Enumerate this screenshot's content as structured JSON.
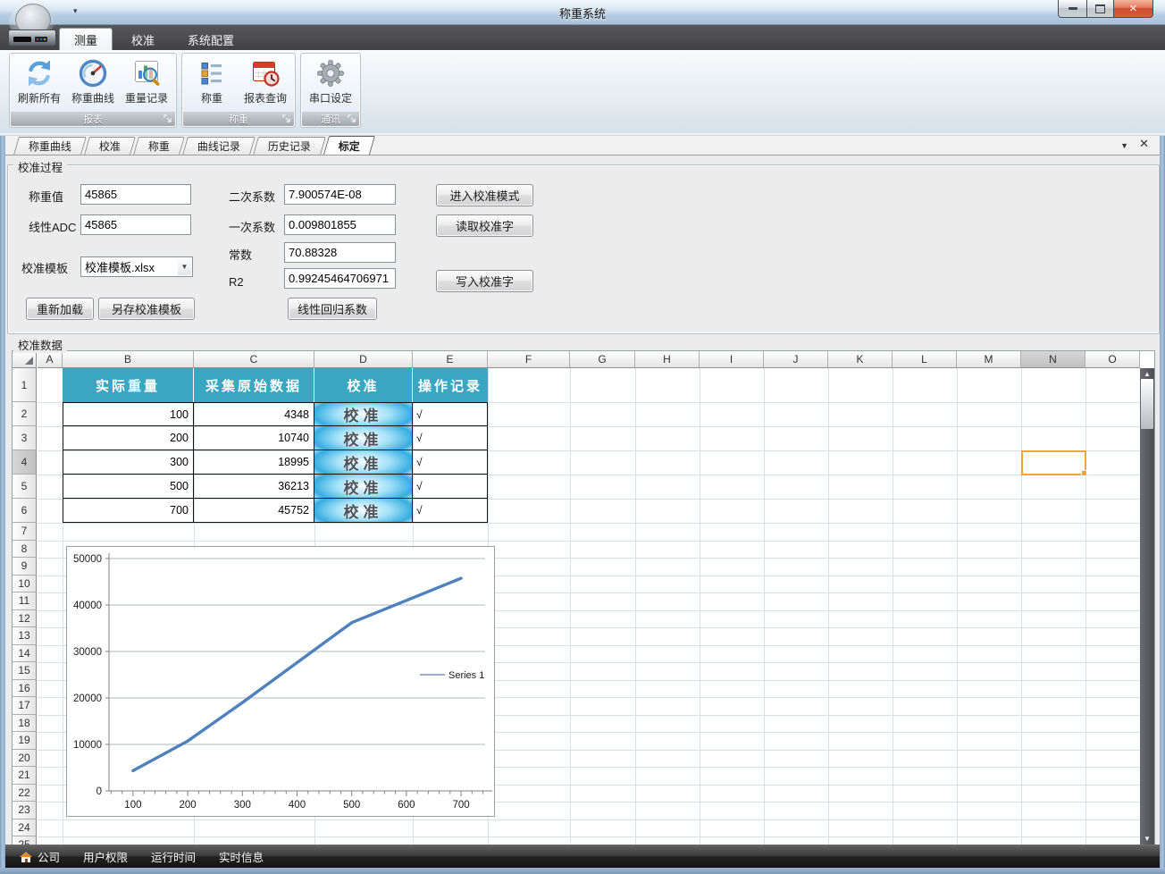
{
  "colors": {
    "accent_teal": "#3AA6C2",
    "selection_orange": "#F0A43C",
    "chart_line": "#4F81BD",
    "glow_blue": "#36ACE0"
  },
  "window": {
    "title": "称重系统"
  },
  "ribbon": {
    "tabs": [
      {
        "name": "measure",
        "label": "测量",
        "active": true
      },
      {
        "name": "calibrate",
        "label": "校准",
        "active": false
      },
      {
        "name": "system-config",
        "label": "系统配置",
        "active": false
      }
    ],
    "groups": [
      {
        "name": "reports",
        "label": "报表",
        "buttons": [
          {
            "name": "refresh-all",
            "label": "刷新所有",
            "icon": "refresh-icon"
          },
          {
            "name": "weigh-curve",
            "label": "称重曲线",
            "icon": "gauge-icon"
          },
          {
            "name": "weight-records",
            "label": "重量记录",
            "icon": "chart-search-icon"
          }
        ]
      },
      {
        "name": "weighing",
        "label": "称重",
        "buttons": [
          {
            "name": "weigh",
            "label": "称重",
            "icon": "list-icon"
          },
          {
            "name": "report-query",
            "label": "报表查询",
            "icon": "calendar-clock-icon"
          }
        ]
      },
      {
        "name": "communication",
        "label": "通讯",
        "buttons": [
          {
            "name": "serial-port-settings",
            "label": "串口设定",
            "icon": "gear-icon"
          }
        ]
      }
    ]
  },
  "doc_tabs": [
    {
      "name": "weigh-curve",
      "label": "称重曲线",
      "active": false
    },
    {
      "name": "calibrate",
      "label": "校准",
      "active": false
    },
    {
      "name": "weigh",
      "label": "称重",
      "active": false
    },
    {
      "name": "curve-records",
      "label": "曲线记录",
      "active": false
    },
    {
      "name": "history-records",
      "label": "历史记录",
      "active": false
    },
    {
      "name": "calibration",
      "label": "标定",
      "active": true
    }
  ],
  "calibration_panel": {
    "group_title": "校准过程",
    "fields": [
      {
        "name": "weigh-value",
        "label": "称重值",
        "value": "45865",
        "type": "input"
      },
      {
        "name": "linear-adc",
        "label": "线性ADC",
        "value": "45865",
        "type": "input"
      },
      {
        "name": "calibration-template",
        "label": "校准模板",
        "value": "校准模板.xlsx",
        "type": "combo"
      },
      {
        "name": "quadratic-coefficient",
        "label": "二次系数",
        "value": "7.900574E-08",
        "type": "input"
      },
      {
        "name": "linear-coefficient",
        "label": "一次系数",
        "value": "0.009801855",
        "type": "input"
      },
      {
        "name": "constant",
        "label": "常数",
        "value": "70.88328",
        "type": "input"
      },
      {
        "name": "r2",
        "label": "R2",
        "value": "0.99245464706971",
        "type": "input"
      }
    ],
    "buttons": [
      {
        "name": "reload",
        "label": "重新加载"
      },
      {
        "name": "save-template-as",
        "label": "另存校准模板"
      },
      {
        "name": "linear-regression",
        "label": "线性回归系数"
      },
      {
        "name": "enter-calibration-mode",
        "label": "进入校准模式"
      },
      {
        "name": "read-calibration-word",
        "label": "读取校准字"
      },
      {
        "name": "write-calibration-word",
        "label": "写入校准字"
      }
    ]
  },
  "sheet": {
    "group_title": "校准数据",
    "columns": [
      "A",
      "B",
      "C",
      "D",
      "E",
      "F",
      "G",
      "H",
      "I",
      "J",
      "K",
      "L",
      "M",
      "N",
      "O"
    ],
    "row_count": 25,
    "selected_column": "N",
    "selected_row": 4,
    "selected_cell": "N4",
    "table": {
      "headers": [
        "实际重量",
        "采集原始数据",
        "校准",
        "操作记录"
      ],
      "rows": [
        {
          "weight": "100",
          "raw": "4348",
          "action": "校准",
          "log": "√"
        },
        {
          "weight": "200",
          "raw": "10740",
          "action": "校准",
          "log": "√"
        },
        {
          "weight": "300",
          "raw": "18995",
          "action": "校准",
          "log": "√"
        },
        {
          "weight": "500",
          "raw": "36213",
          "action": "校准",
          "log": "√"
        },
        {
          "weight": "700",
          "raw": "45752",
          "action": "校准",
          "log": "√"
        }
      ]
    }
  },
  "chart_data": {
    "type": "line",
    "title": "",
    "series": [
      {
        "name": "Series 1",
        "x": [
          100,
          200,
          300,
          500,
          700
        ],
        "y": [
          4348,
          10740,
          18995,
          36213,
          45752
        ]
      }
    ],
    "xticks": [
      100,
      200,
      300,
      400,
      500,
      600,
      700
    ],
    "yticks": [
      0,
      10000,
      20000,
      30000,
      40000,
      50000
    ],
    "xlim": [
      56,
      744
    ],
    "ylim": [
      0,
      50000
    ],
    "grid": "horizontal",
    "legend_position": "middle-right",
    "line_color": "#4F81BD"
  },
  "status_bar": {
    "items": [
      {
        "name": "company",
        "label": "公司",
        "icon": "home-icon"
      },
      {
        "name": "user-permissions",
        "label": "用户权限"
      },
      {
        "name": "run-time",
        "label": "运行时间"
      },
      {
        "name": "realtime-info",
        "label": "实时信息"
      }
    ]
  }
}
